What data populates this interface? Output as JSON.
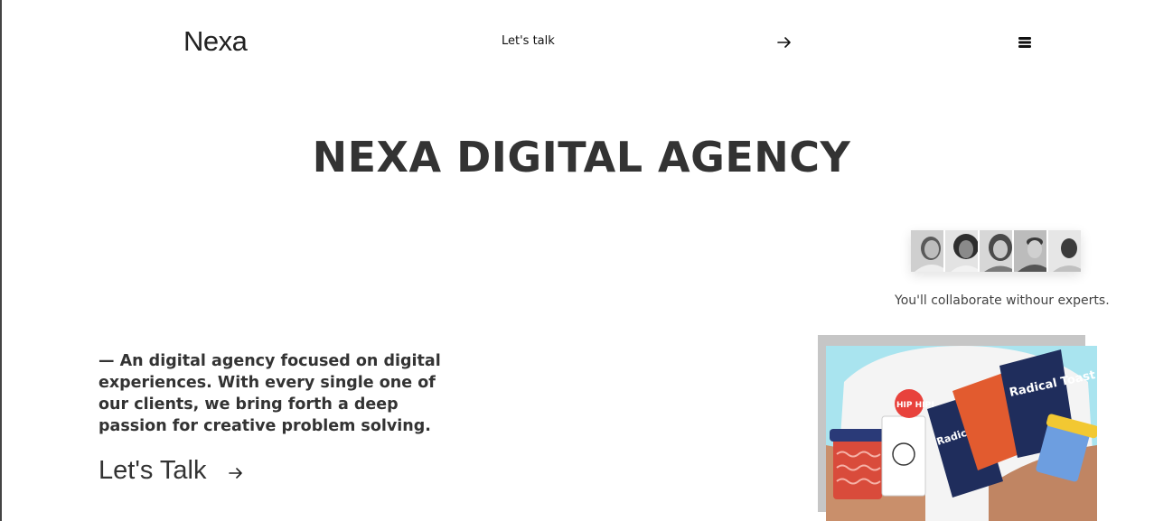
{
  "header": {
    "logo": "Nexa",
    "nav_link": "Let's talk"
  },
  "hero": {
    "title": "NEXA DIGITAL AGENCY"
  },
  "team": {
    "caption": "You'll collaborate withour experts."
  },
  "intro": {
    "text": "— An digital agency focused on digital experiences. With every single one of our clients, we bring forth a deep passion for creative problem solving."
  },
  "cta": {
    "label": "Let's Talk"
  },
  "icons": {
    "nav_arrow": "arrow-right-icon",
    "menu": "hamburger-menu-icon",
    "cta_arrow": "arrow-right-icon"
  },
  "colors": {
    "text": "#333333",
    "photo_bg": "#a9e4ef",
    "frame": "#c6c6c6"
  },
  "photo": {
    "texts": [
      "HIP HIP!",
      "Radical Toast",
      "Radical Toast"
    ]
  }
}
